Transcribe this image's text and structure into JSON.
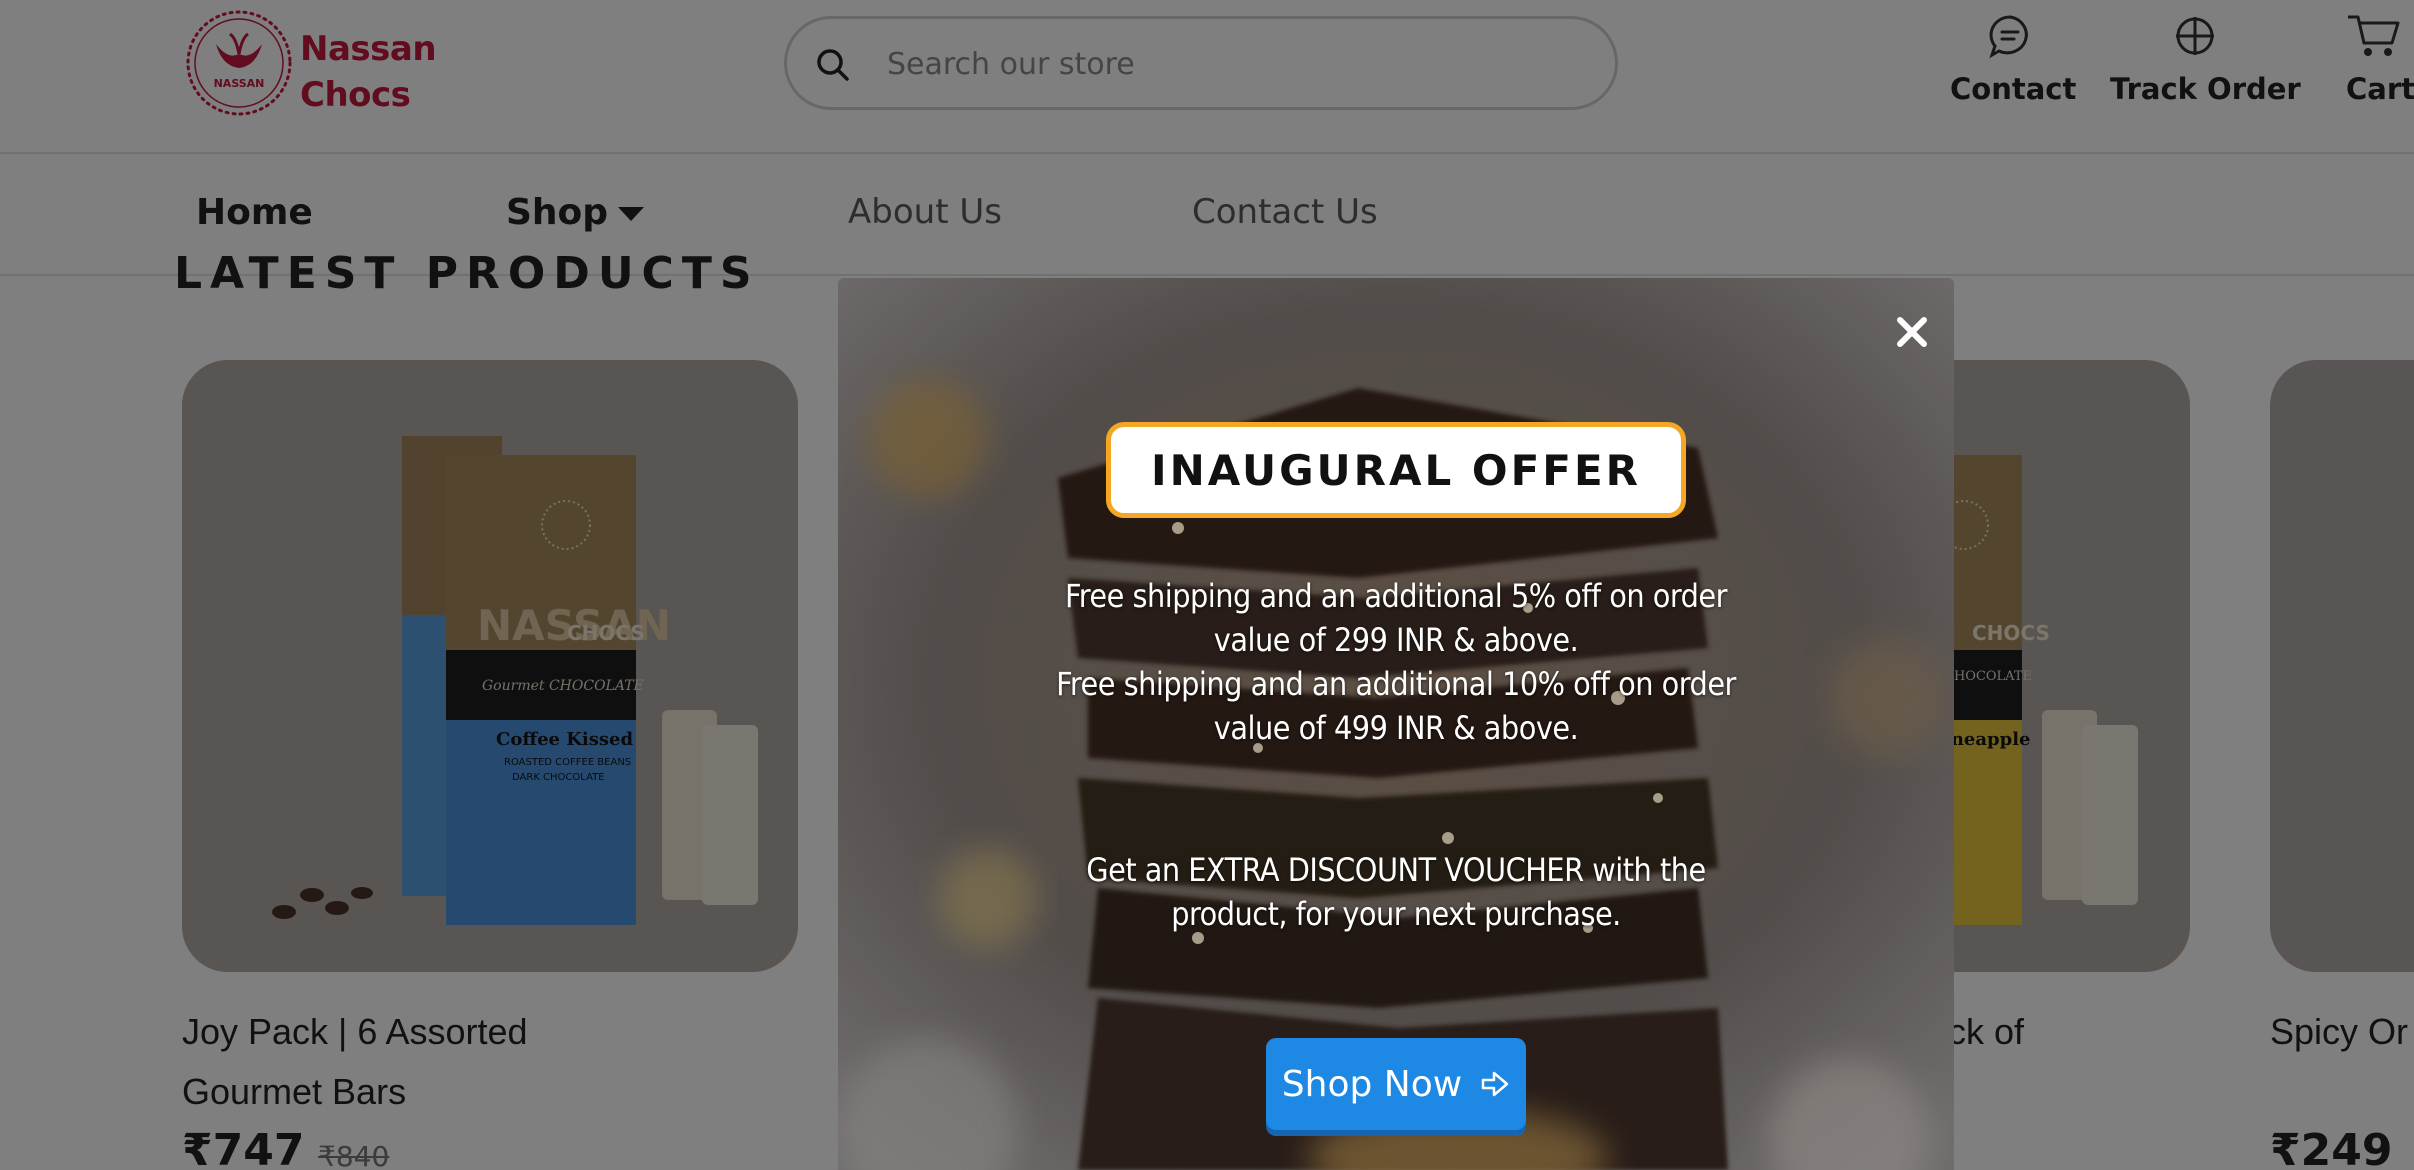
{
  "brand": {
    "name_line1": "Nassan",
    "name_line2": "Chocs",
    "seal_text": "NASSAN",
    "color": "#c4183f"
  },
  "search": {
    "placeholder": "Search our store"
  },
  "header_actions": [
    {
      "label": "Contact",
      "icon": "chat-bubble-icon"
    },
    {
      "label": "Track Order",
      "icon": "crosshair-icon"
    },
    {
      "label": "Cart",
      "icon": "cart-icon"
    }
  ],
  "nav": {
    "items": [
      {
        "label": "Home"
      },
      {
        "label": "Shop",
        "has_dropdown": true
      },
      {
        "label": "About Us"
      },
      {
        "label": "Contact Us"
      }
    ]
  },
  "section": {
    "title": "LATEST PRODUCTS"
  },
  "products": [
    {
      "title_line1": "Joy Pack | 6 Assorted",
      "title_line2": "Gourmet Bars",
      "price": "₹747",
      "old_price": "₹840",
      "package_brand": "NASSAN",
      "package_sub": "CHOCS",
      "package_script": "Gourmet CHOCOLATE",
      "package_flavor": "Coffee Kissed",
      "package_desc_line1": "ROASTED COFFEE BEANS",
      "package_desc_line2": "DARK CHOCOLATE"
    },
    {
      "title_partial": "ck of",
      "package_sub": "CHOCS",
      "package_script": "CHOCOLATE",
      "package_flavor": "ineapple"
    },
    {
      "title_partial": "Spicy Or",
      "price": "₹249"
    }
  ],
  "modal": {
    "title": "INAUGURAL OFFER",
    "lines": [
      "Free shipping and an additional 5% off on order",
      "value of 299 INR & above.",
      "Free shipping and an additional 10% off on order",
      "value of 499 INR & above.",
      "Get an EXTRA DISCOUNT VOUCHER with the",
      "product, for your next purchase."
    ],
    "button_label": "Shop Now",
    "accent": "#f5a623",
    "button_color": "#1e88e5"
  }
}
